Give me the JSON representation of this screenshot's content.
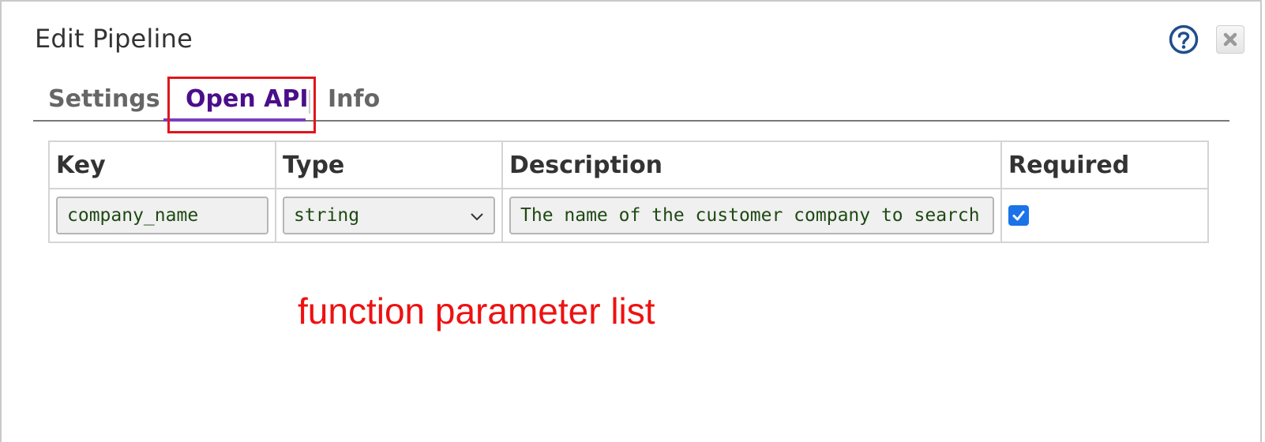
{
  "dialog": {
    "title": "Edit Pipeline",
    "help_icon": "question-circle-icon",
    "close_icon": "close-x-icon"
  },
  "tabs": [
    {
      "label": "Settings",
      "active": false
    },
    {
      "label": "Open API",
      "active": true
    },
    {
      "label": "Info",
      "active": false
    }
  ],
  "table": {
    "headers": [
      "Key",
      "Type",
      "Description",
      "Required"
    ],
    "rows": [
      {
        "key": "company_name",
        "type": "string",
        "description": "The name of the customer company to search",
        "required": true
      }
    ]
  },
  "annotation": {
    "text": "function parameter list",
    "color": "#ee1111"
  },
  "colors": {
    "active_tab": "#4b0e8a",
    "tab_underline": "#7a3fbf",
    "highlight": "#e0161b",
    "checkbox": "#1a73e8",
    "help_icon": "#1f4e8c"
  }
}
